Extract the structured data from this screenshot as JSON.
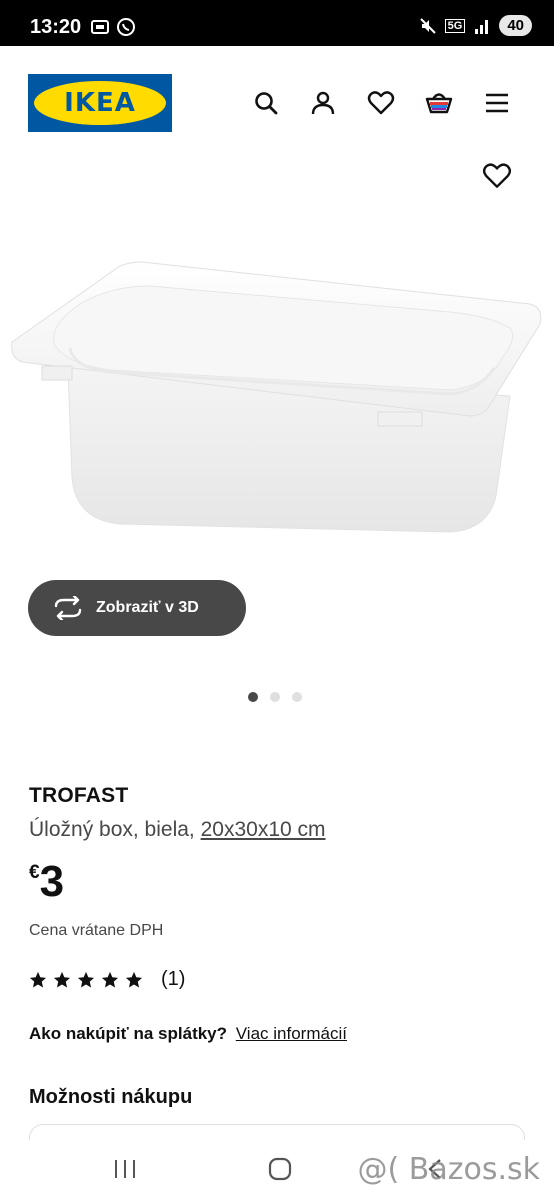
{
  "status_bar": {
    "time": "13:20",
    "network": "5G",
    "battery": "40",
    "icons": [
      "screenshot-icon",
      "whatsapp-icon",
      "mute-icon",
      "signal-icon"
    ]
  },
  "header": {
    "logo_text": "IKEA",
    "icons": [
      "search-icon",
      "account-icon",
      "favorites-icon",
      "cart-icon",
      "menu-icon"
    ]
  },
  "product": {
    "name": "TROFAST",
    "description": "Úložný box, biela,",
    "size": "20x30x10 cm",
    "price_currency": "€",
    "price": "3",
    "vat_note": "Cena vrátane DPH",
    "rating_stars": 5,
    "rating_count": "(1)"
  },
  "gallery": {
    "view_3d_label": "Zobraziť v 3D",
    "image_count": 3,
    "active_index": 0
  },
  "installments": {
    "question": "Ako nakúpiť na splátky?",
    "link": "Viac informácií"
  },
  "purchase": {
    "title": "Možnosti nákupu"
  },
  "watermark": "@( Bazos.sk",
  "colors": {
    "ikea_blue": "#0058a3",
    "ikea_yellow": "#ffdb00",
    "button_dark": "#484848"
  }
}
